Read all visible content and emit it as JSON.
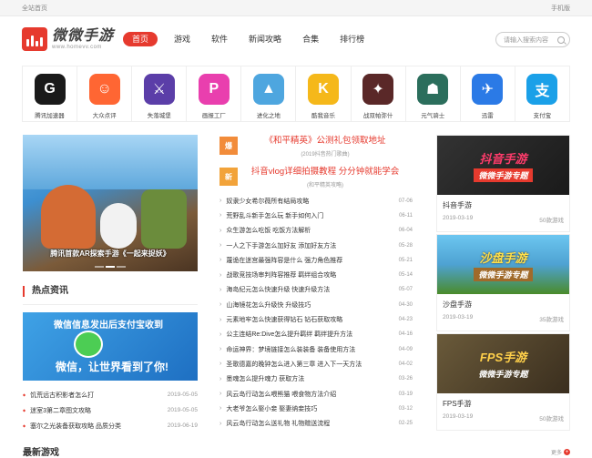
{
  "topbar": {
    "left": "全站首页",
    "right": "手机版"
  },
  "logo": {
    "name": "微微手游",
    "url_text": "www.homevv.com"
  },
  "nav": [
    {
      "label": "首页",
      "active": true
    },
    {
      "label": "游戏"
    },
    {
      "label": "软件"
    },
    {
      "label": "新闻攻略"
    },
    {
      "label": "合集"
    },
    {
      "label": "排行榜"
    }
  ],
  "search": {
    "placeholder": "请输入搜索内容"
  },
  "apps": [
    {
      "name": "腾讯加速器",
      "color": "#1a1a1a",
      "glyph": "G",
      "icon": "tencent-accelerator-icon"
    },
    {
      "name": "大众点评",
      "color": "#ff6633",
      "glyph": "☺",
      "icon": "dianping-icon"
    },
    {
      "name": "失落城堡",
      "color": "#5b3ea8",
      "glyph": "⚔",
      "icon": "lost-castle-icon"
    },
    {
      "name": "画报工厂",
      "color": "#e93fae",
      "glyph": "P",
      "icon": "picture-factory-icon"
    },
    {
      "name": "进化之地",
      "color": "#4ea6df",
      "glyph": "▲",
      "icon": "evoland-icon"
    },
    {
      "name": "酷我音乐",
      "color": "#f5b81a",
      "glyph": "K",
      "icon": "kuwo-music-icon"
    },
    {
      "name": "战双帕弥什",
      "color": "#5a2828",
      "glyph": "✦",
      "icon": "punishing-icon"
    },
    {
      "name": "元气骑士",
      "color": "#2b6e5c",
      "glyph": "☗",
      "icon": "soul-knight-icon"
    },
    {
      "name": "迅雷",
      "color": "#2b7ae6",
      "glyph": "✈",
      "icon": "xunlei-icon"
    },
    {
      "name": "支付宝",
      "color": "#1aa0e8",
      "glyph": "支",
      "icon": "alipay-icon"
    }
  ],
  "banner": {
    "title": "腾讯首款AR探索手游《一起来捉妖》"
  },
  "hot_section": {
    "title": "热点资讯"
  },
  "promo": {
    "line1": "微信信息发出后支付宝收到",
    "line2": "微信，让世界看到了你!"
  },
  "left_news": [
    {
      "title": "饥荒远古积影者怎么打",
      "date": "2019-05-05"
    },
    {
      "title": "迷室3第二章图文攻略",
      "date": "2019-05-05"
    },
    {
      "title": "塞尔之光装备获取攻略 品质分类",
      "date": "2019-06-19"
    }
  ],
  "latest": {
    "title": "最新游戏",
    "more": "更多"
  },
  "hot_items": [
    {
      "badge": "爆",
      "title": "《和平精英》公测礼包领取地址",
      "sub": "(2019抖音热门歌曲)"
    },
    {
      "badge": "新",
      "title": "抖音vlog详细拍摄教程 分分钟就能学会",
      "sub": "(和平精英攻略)"
    }
  ],
  "center_news": [
    {
      "title": "奴隶少女希尔薇所有结局攻略",
      "date": "07-06"
    },
    {
      "title": "荒野乱斗新手怎么玩 新手如何入门",
      "date": "06-11"
    },
    {
      "title": "众生游怎么吃饭 吃饭方法解析",
      "date": "06-04"
    },
    {
      "title": "一人之下手游怎么加好友 添加好友方法",
      "date": "05-28"
    },
    {
      "title": "蔑诡在迷宫最强阵容是什么 强力角色推荐",
      "date": "05-21"
    },
    {
      "title": "战歌竞技场审判阵容推荐 羁绊组合攻略",
      "date": "05-14"
    },
    {
      "title": "海岛纪元怎么快速升级 快速升级方法",
      "date": "05-07"
    },
    {
      "title": "山海镜花怎么升级快 升级技巧",
      "date": "04-30"
    },
    {
      "title": "元素地牢怎么快速获得钻石 钻石获取攻略",
      "date": "04-23"
    },
    {
      "title": "公主连结Re:Dive怎么提升羁绊 羁绊提升方法",
      "date": "04-16"
    },
    {
      "title": "命运神界：梦境链接怎么装装备 装备使用方法",
      "date": "04-09"
    },
    {
      "title": "圣歌德嘉的晚钟怎么进入第三章 进入下一天方法",
      "date": "04-02"
    },
    {
      "title": "墨魂怎么提升魂力 获取方法",
      "date": "03-26"
    },
    {
      "title": "风云岛行动怎么喂熊猫 喂食物方法介绍",
      "date": "03-19"
    },
    {
      "title": "大老爷怎么娶小妾 娶妻纳妾技巧",
      "date": "03-12"
    },
    {
      "title": "风云岛行动怎么送礼物 礼物赠送流程",
      "date": "02-25"
    }
  ],
  "cards": [
    {
      "name": "抖音手游",
      "date": "2019-03-19",
      "count": "50款游戏",
      "img_a": "抖音手游",
      "img_b": "微微手游专题"
    },
    {
      "name": "沙盘手游",
      "date": "2019-03-19",
      "count": "35款游戏",
      "img_a": "沙盘手游",
      "img_b": "微微手游专题"
    },
    {
      "name": "FPS手游",
      "date": "2019-03-19",
      "count": "50款游戏",
      "img_a": "FPS手游",
      "img_b": "微微手游专题"
    }
  ]
}
